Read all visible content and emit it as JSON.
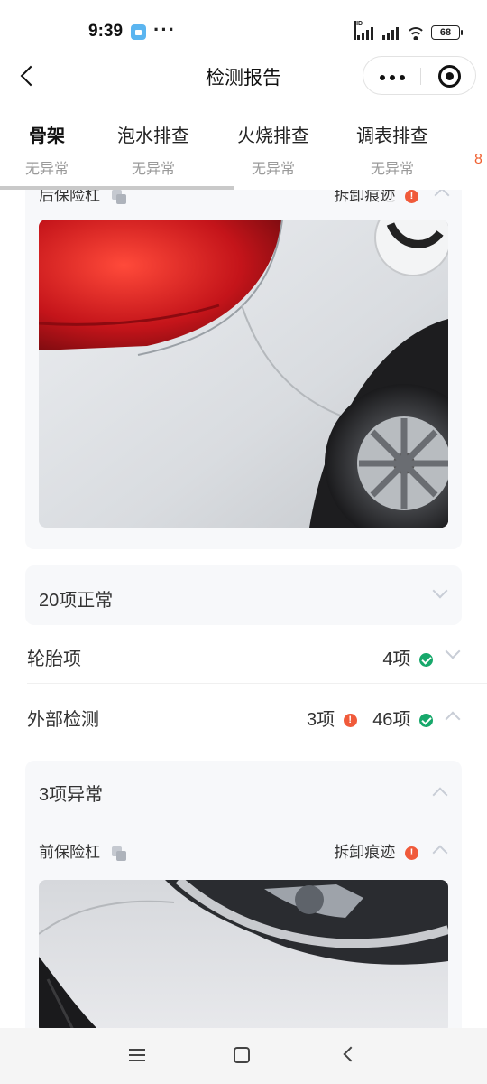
{
  "status_bar": {
    "time": "9:39",
    "more": "···",
    "battery": "68",
    "hd": "HD"
  },
  "nav": {
    "title": "检测报告",
    "back_icon": "chevron-left-icon",
    "more_icon": "more-dots-icon",
    "close_icon": "target-close-icon"
  },
  "tabs": [
    {
      "title": "骨架",
      "sub": "无异常",
      "active": true
    },
    {
      "title": "泡水排查",
      "sub": "无异常",
      "active": false
    },
    {
      "title": "火烧排查",
      "sub": "无异常",
      "active": false
    },
    {
      "title": "调表排查",
      "sub": "无异常",
      "active": false
    }
  ],
  "tab_peek": "8",
  "cut_item": {
    "label": "后保险杠",
    "status": "拆卸痕迹"
  },
  "normal_group": {
    "label": "20项正常"
  },
  "tire_row": {
    "label": "轮胎项",
    "ok_count": "4项"
  },
  "exterior_row": {
    "label": "外部检测",
    "warn_count": "3项",
    "ok_count": "46项"
  },
  "abnormal_group": {
    "label": "3项异常",
    "item_label": "前保险杠",
    "item_status": "拆卸痕迹"
  },
  "colors": {
    "warn": "#f05a3a",
    "ok": "#17a86b",
    "card_bg": "#f7f8fa",
    "tab_peek": "#f06030"
  }
}
